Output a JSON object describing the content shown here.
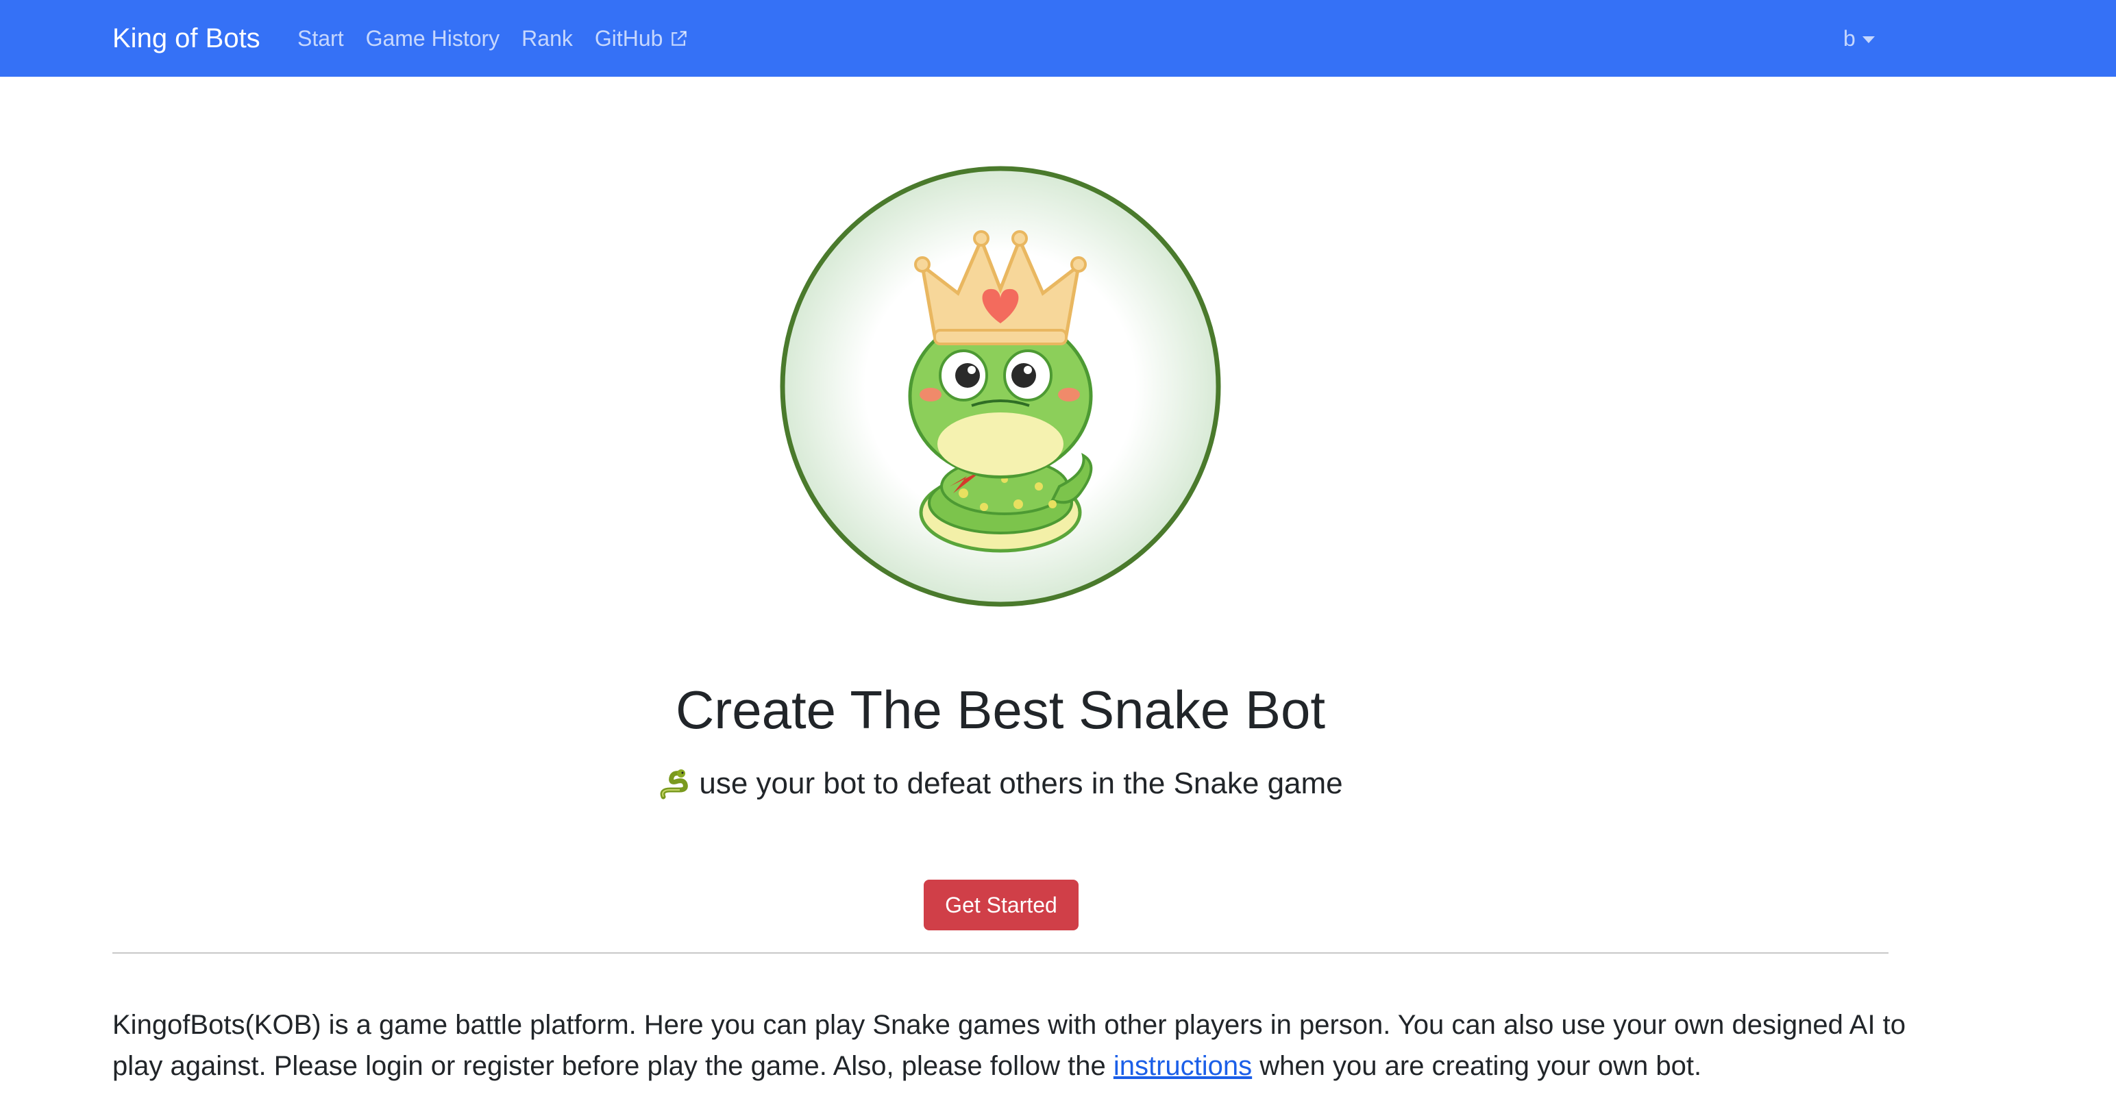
{
  "navbar": {
    "brand": "King of Bots",
    "links": [
      {
        "label": "Start"
      },
      {
        "label": "Game History"
      },
      {
        "label": "Rank"
      },
      {
        "label": "GitHub",
        "icon": "external-link-icon"
      }
    ],
    "user": "b",
    "bg_color": "#3571f6"
  },
  "hero": {
    "logo_icon": "king-snake-logo",
    "title": "Create The Best Snake Bot",
    "subtitle_icon": "snake-emoji-icon",
    "subtitle": "use your bot to defeat others in the Snake game",
    "cta_label": "Get Started",
    "cta_color": "#d03f48"
  },
  "about": {
    "text_before": "KingofBots(KOB) is a game battle platform. Here you can play Snake games with other players in person. You can also use your own designed AI to play against. Please login or register before play the game. Also, please follow the ",
    "link_text": "instructions",
    "text_after": " when you are creating your own bot."
  }
}
